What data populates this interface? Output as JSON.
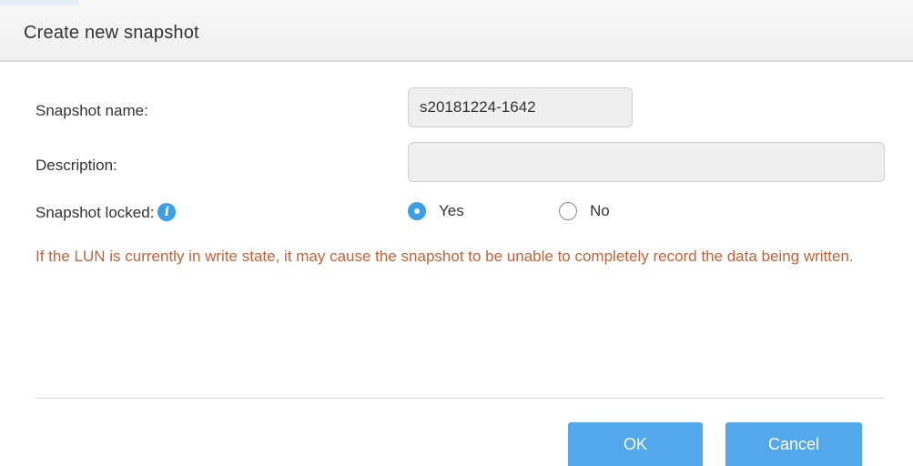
{
  "dialog": {
    "title": "Create new snapshot"
  },
  "form": {
    "snapshot_name": {
      "label": "Snapshot name:",
      "value": "s20181224-1642"
    },
    "description": {
      "label": "Description:",
      "value": ""
    },
    "snapshot_locked": {
      "label": "Snapshot locked:",
      "info_icon": "info-icon",
      "options": [
        {
          "label": "Yes",
          "selected": true
        },
        {
          "label": "No",
          "selected": false
        }
      ]
    },
    "warning": "If the LUN is currently in write state, it may cause the snapshot to be unable to completely record the data being written."
  },
  "buttons": {
    "ok": "OK",
    "cancel": "Cancel"
  },
  "colors": {
    "accent": "#3a9ee8",
    "button": "#52a8ea",
    "warning": "#c0633a"
  }
}
